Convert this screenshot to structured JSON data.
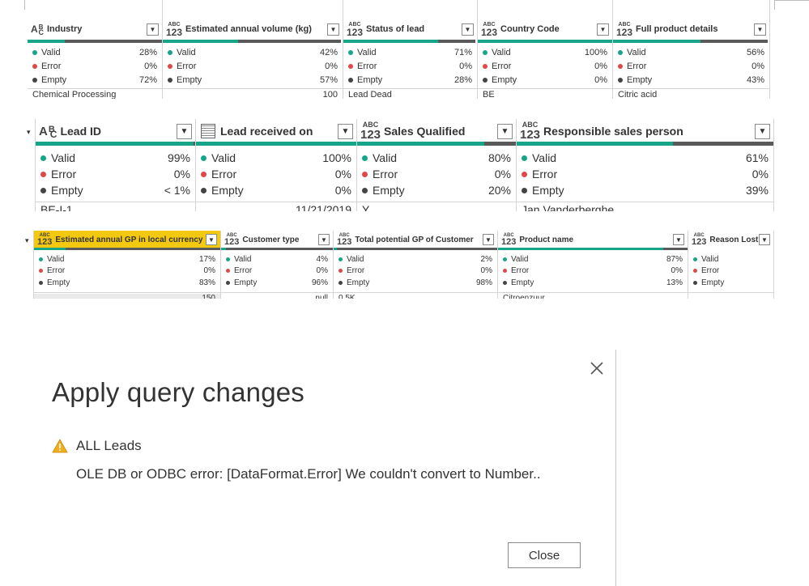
{
  "strip1": {
    "columns": [
      {
        "name": "Industry",
        "type": "text",
        "valid": "28%",
        "error": "0%",
        "empty": "72%",
        "bar": [
          28,
          0,
          72
        ],
        "first": "Chemical Processing",
        "align": "left"
      },
      {
        "name": "Estimated annual volume (kg)",
        "type": "any",
        "valid": "42%",
        "error": "0%",
        "empty": "57%",
        "bar": [
          42,
          0,
          57
        ],
        "first": "100",
        "align": "right"
      },
      {
        "name": "Status of lead",
        "type": "any",
        "valid": "71%",
        "error": "0%",
        "empty": "28%",
        "bar": [
          71,
          0,
          28
        ],
        "first": "Lead Dead",
        "align": "left"
      },
      {
        "name": "Country Code",
        "type": "any",
        "valid": "100%",
        "error": "0%",
        "empty": "0%",
        "bar": [
          100,
          0,
          0
        ],
        "first": "BE",
        "align": "left"
      },
      {
        "name": "Full product details",
        "type": "any",
        "valid": "56%",
        "error": "0%",
        "empty": "43%",
        "bar": [
          56,
          0,
          43
        ],
        "first": "Citric acid",
        "align": "left"
      }
    ]
  },
  "strip2": {
    "columns": [
      {
        "name": "Lead ID",
        "type": "text",
        "valid": "99%",
        "error": "0%",
        "empty": "< 1%",
        "bar": [
          99,
          0,
          1
        ],
        "first": "BE-I-1",
        "align": "left"
      },
      {
        "name": "Lead received on",
        "type": "date",
        "valid": "100%",
        "error": "0%",
        "empty": "0%",
        "bar": [
          100,
          0,
          0
        ],
        "first": "11/21/2019",
        "align": "right"
      },
      {
        "name": "Sales Qualified",
        "type": "any",
        "valid": "80%",
        "error": "0%",
        "empty": "20%",
        "bar": [
          80,
          0,
          20
        ],
        "first": "Y",
        "align": "left"
      },
      {
        "name": "Responsible sales person",
        "type": "any",
        "valid": "61%",
        "error": "0%",
        "empty": "39%",
        "bar": [
          61,
          0,
          39
        ],
        "first": "Jan Vanderberghe",
        "align": "left"
      }
    ]
  },
  "strip3": {
    "columns": [
      {
        "name": "Estimated annual GP in local currency",
        "type": "any",
        "valid": "17%",
        "error": "0%",
        "empty": "83%",
        "bar": [
          17,
          0,
          83
        ],
        "first": "150",
        "align": "right",
        "selected": true
      },
      {
        "name": "Customer type",
        "type": "any",
        "valid": "4%",
        "error": "0%",
        "empty": "96%",
        "bar": [
          4,
          0,
          96
        ],
        "first": "null",
        "align": "right"
      },
      {
        "name": "Total potential GP of Customer",
        "type": "any",
        "valid": "2%",
        "error": "0%",
        "empty": "98%",
        "bar": [
          2,
          0,
          98
        ],
        "first": "0.5K",
        "align": "left"
      },
      {
        "name": "Product name",
        "type": "any",
        "valid": "87%",
        "error": "0%",
        "empty": "13%",
        "bar": [
          87,
          0,
          13
        ],
        "first": "Citroenzuur",
        "align": "left"
      },
      {
        "name": "Reason Lost",
        "type": "any",
        "valid": "",
        "error": "",
        "empty": "",
        "bar": [
          0,
          0,
          0
        ],
        "first": "",
        "align": "left"
      }
    ]
  },
  "labels": {
    "valid": "Valid",
    "error": "Error",
    "empty": "Empty"
  },
  "type_glyph": {
    "text_top": "A",
    "text_sub": "B",
    "text_sub2": "C",
    "num_top": "ABC",
    "num_bot": "123"
  },
  "dialog": {
    "title": "Apply query changes",
    "source": "ALL Leads",
    "message": "OLE DB or ODBC error: [DataFormat.Error] We couldn't convert to Number..",
    "close_button": "Close",
    "close_icon": "close-x-icon",
    "warning_icon": "warning-triangle-icon"
  },
  "colors": {
    "valid": "#17a589",
    "error": "#e04848",
    "empty": "#444444",
    "selected_header": "#f2c811"
  }
}
